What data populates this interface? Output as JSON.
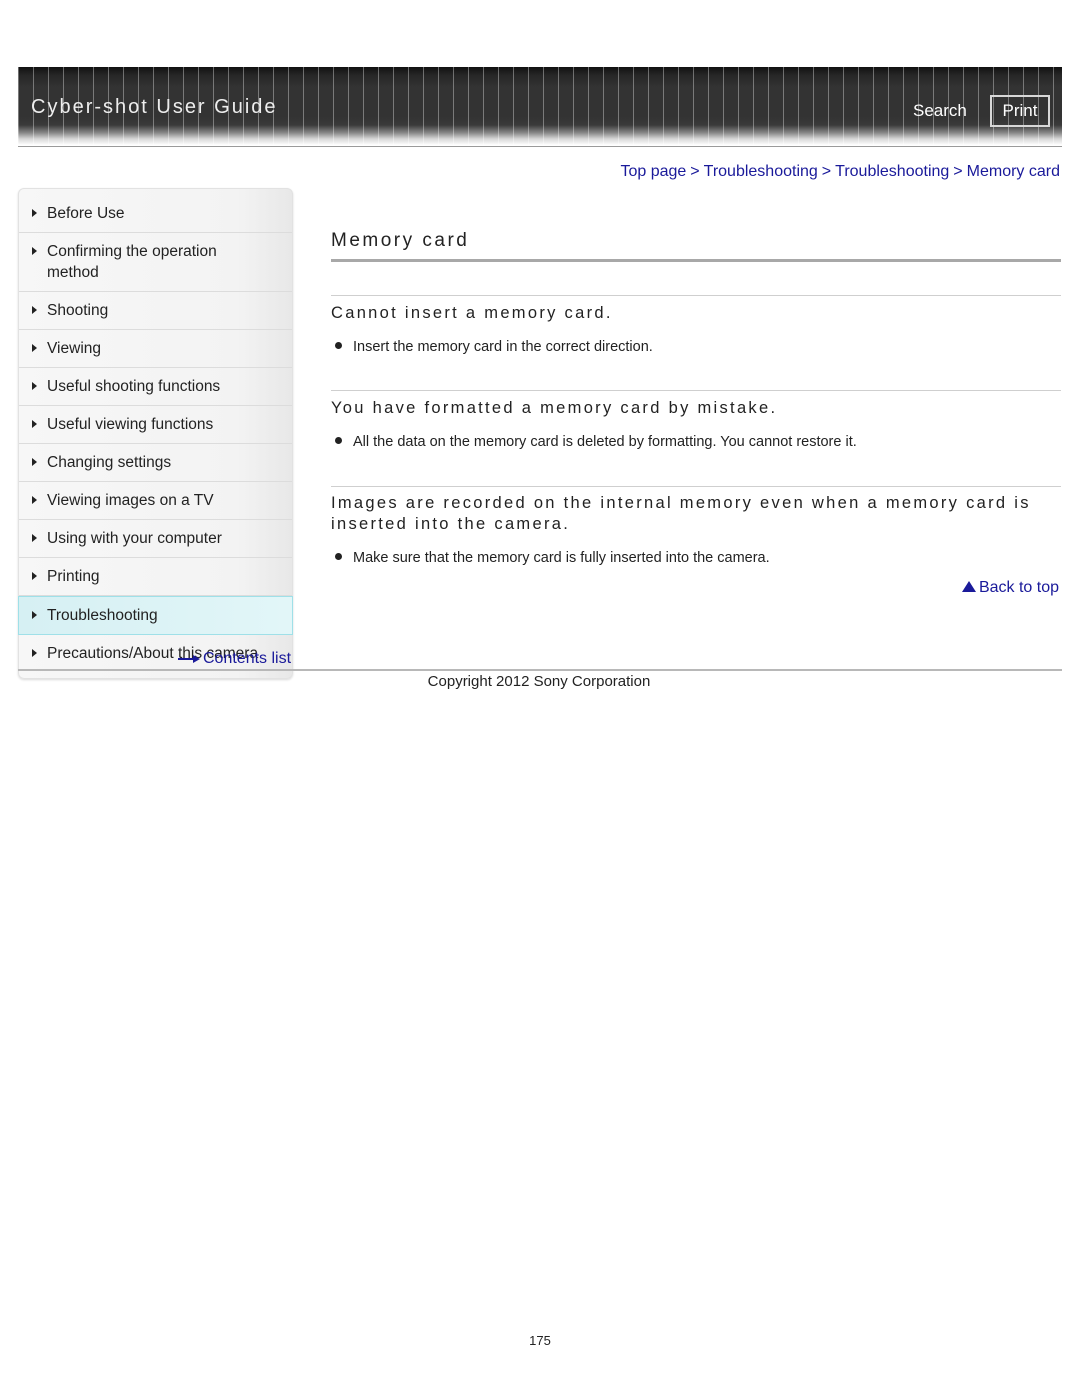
{
  "header": {
    "title": "Cyber-shot User Guide",
    "search_label": "Search",
    "print_label": "Print"
  },
  "breadcrumb": {
    "items": [
      "Top page",
      "Troubleshooting",
      "Troubleshooting",
      "Memory card"
    ],
    "separator": ">"
  },
  "sidebar": {
    "items": [
      {
        "label": "Before Use"
      },
      {
        "label": "Confirming the operation method"
      },
      {
        "label": "Shooting"
      },
      {
        "label": "Viewing"
      },
      {
        "label": "Useful shooting functions"
      },
      {
        "label": "Useful viewing functions"
      },
      {
        "label": "Changing settings"
      },
      {
        "label": "Viewing images on a TV"
      },
      {
        "label": "Using with your computer"
      },
      {
        "label": "Printing"
      },
      {
        "label": "Troubleshooting",
        "active": true
      },
      {
        "label": "Precautions/About this camera"
      }
    ],
    "contents_link": "Contents list"
  },
  "main": {
    "title": "Memory card",
    "sections": [
      {
        "heading": "Cannot insert a memory card.",
        "bullets": [
          "Insert the memory card in the correct direction."
        ]
      },
      {
        "heading": "You have formatted a memory card by mistake.",
        "bullets": [
          "All the data on the memory card is deleted by formatting. You cannot restore it."
        ]
      },
      {
        "heading": "Images are recorded on the internal memory even when a memory card is inserted into the camera.",
        "bullets": [
          "Make sure that the memory card is fully inserted into the camera."
        ]
      }
    ],
    "back_to_top": "Back to top"
  },
  "footer": {
    "copyright": "Copyright 2012 Sony Corporation",
    "page_number": "175"
  }
}
